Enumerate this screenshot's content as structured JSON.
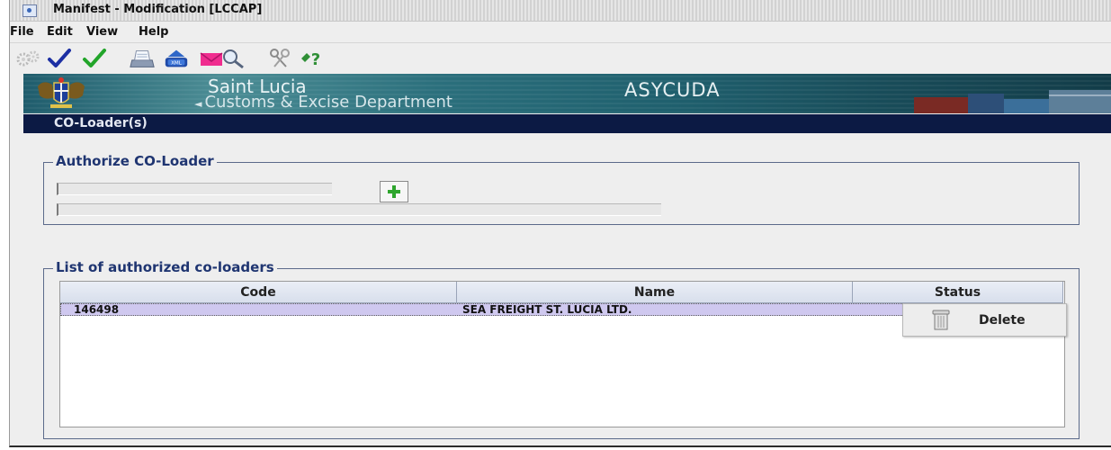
{
  "window": {
    "title": "Manifest - Modification [LCCAP]"
  },
  "menu": [
    "File",
    "Edit",
    "View",
    "Help"
  ],
  "toolbar": {
    "icons": [
      "settings-gears-icon",
      "verify-check-icon",
      "store-check-icon",
      "print-icon",
      "xml-export-icon",
      "mail-icon",
      "search-icon",
      "keys-icon",
      "help-icon"
    ]
  },
  "banner": {
    "country": "Saint Lucia",
    "department": "Customs & Excise Department",
    "system": "ASYCUDA"
  },
  "section": {
    "title": "CO-Loader(s)"
  },
  "authorize": {
    "legend": "Authorize CO-Loader",
    "code_value": "",
    "name_value": ""
  },
  "list": {
    "legend": "List of authorized co-loaders",
    "columns": [
      "Code",
      "Name",
      "Status"
    ],
    "rows": [
      {
        "code": "146498",
        "name": "SEA FREIGHT ST. LUCIA LTD.",
        "status": ""
      }
    ]
  },
  "context_menu": {
    "delete_label": "Delete"
  },
  "colors": {
    "section_bar": "#0c1a44",
    "legend_text": "#1f3571",
    "selected_row": "#cfc8ef",
    "banner": "#1f5c6c"
  }
}
